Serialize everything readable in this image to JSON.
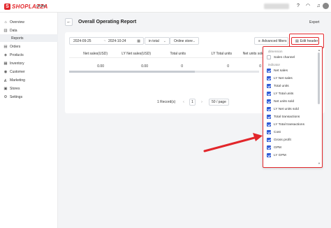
{
  "brand": {
    "name": "SHOPLAZZA",
    "mark": "S",
    "color": "#e2262b"
  },
  "store": {
    "name": "center"
  },
  "topbar": {
    "icons": [
      "question-icon",
      "wifi-icon",
      "bell-icon"
    ]
  },
  "sidebar": {
    "items": [
      {
        "label": "Overview",
        "icon": "⌂"
      },
      {
        "label": "Data",
        "icon": "▥"
      },
      {
        "label": "Reports",
        "icon": ""
      },
      {
        "label": "Orders",
        "icon": "▤"
      },
      {
        "label": "Products",
        "icon": "◈"
      },
      {
        "label": "Inventory",
        "icon": "▦"
      },
      {
        "label": "Customer",
        "icon": "◉"
      },
      {
        "label": "Marketing",
        "icon": "◭"
      },
      {
        "label": "Stores",
        "icon": "▣"
      },
      {
        "label": "Settings",
        "icon": "⚙"
      }
    ]
  },
  "page": {
    "title": "Overall Operating Report",
    "back": "←",
    "export_label": "Export"
  },
  "filters": {
    "date_start": "2024-09-25",
    "date_end": "2024-10-24",
    "date_sep": "~",
    "select_a": "in total",
    "select_b": "Online store",
    "advanced_label": "Advanced filters",
    "edit_header_label": "Edit header"
  },
  "table": {
    "headers": [
      "Net sales(USD)",
      "LY Net sales(USD)",
      "Total units",
      "LY Total units",
      "Net units sold"
    ],
    "row": [
      "0.00",
      "0.00",
      "0",
      "0",
      "0"
    ]
  },
  "pagination": {
    "total_label": "1 Record(s)",
    "prev": "‹",
    "current": "1",
    "next": "›",
    "page_size": "50 / page"
  },
  "header_panel": {
    "dimension_label": "dimension",
    "dimension_items": [
      {
        "label": "Sales channel",
        "checked": false
      }
    ],
    "indicator_label": "indicator",
    "indicator_items": [
      {
        "label": "Net sales",
        "checked": true
      },
      {
        "label": "LY Net sales",
        "checked": true
      },
      {
        "label": "Total units",
        "checked": true
      },
      {
        "label": "LY Total units",
        "checked": true
      },
      {
        "label": "Net units sold",
        "checked": true
      },
      {
        "label": "LY Net units sold",
        "checked": true
      },
      {
        "label": "Total transactions",
        "checked": true
      },
      {
        "label": "LY Total transactions",
        "checked": true
      },
      {
        "label": "Cost",
        "checked": true
      },
      {
        "label": "Gross profit",
        "checked": true
      },
      {
        "label": "GPM",
        "checked": true
      },
      {
        "label": "LY GPM",
        "checked": true
      }
    ]
  },
  "colors": {
    "accent": "#e2262b",
    "checkbox": "#2f5bd6"
  }
}
